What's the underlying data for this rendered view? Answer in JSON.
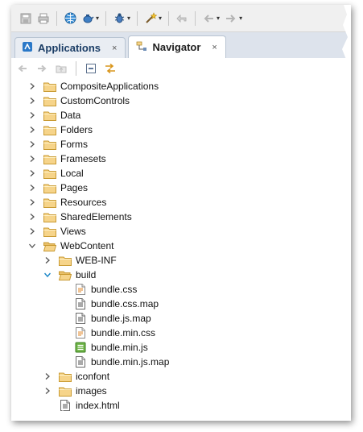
{
  "toolbar": {
    "icons": [
      "save-icon",
      "print-icon",
      "globe-icon",
      "teapot-icon",
      "bug-icon",
      "wand-icon",
      "back-icon",
      "forward-icon"
    ]
  },
  "tabs": [
    {
      "label": "Applications",
      "icon": "applications-icon",
      "close": "×",
      "active": false
    },
    {
      "label": "Navigator",
      "icon": "navigator-icon",
      "close": "×",
      "active": true
    }
  ],
  "viewbar": {
    "icons": [
      "back-arrow-icon",
      "forward-arrow-icon",
      "up-folder-icon",
      "collapse-all-icon",
      "link-editor-icon"
    ]
  },
  "tree": [
    {
      "label": "CompositeApplications",
      "depth": 0,
      "type": "folder",
      "expander": "collapsed"
    },
    {
      "label": "CustomControls",
      "depth": 0,
      "type": "folder",
      "expander": "collapsed"
    },
    {
      "label": "Data",
      "depth": 0,
      "type": "folder",
      "expander": "collapsed"
    },
    {
      "label": "Folders",
      "depth": 0,
      "type": "folder",
      "expander": "collapsed"
    },
    {
      "label": "Forms",
      "depth": 0,
      "type": "folder",
      "expander": "collapsed"
    },
    {
      "label": "Framesets",
      "depth": 0,
      "type": "folder",
      "expander": "collapsed"
    },
    {
      "label": "Local",
      "depth": 0,
      "type": "folder",
      "expander": "collapsed"
    },
    {
      "label": "Pages",
      "depth": 0,
      "type": "folder",
      "expander": "collapsed"
    },
    {
      "label": "Resources",
      "depth": 0,
      "type": "folder",
      "expander": "collapsed"
    },
    {
      "label": "SharedElements",
      "depth": 0,
      "type": "folder",
      "expander": "collapsed"
    },
    {
      "label": "Views",
      "depth": 0,
      "type": "folder",
      "expander": "collapsed"
    },
    {
      "label": "WebContent",
      "depth": 0,
      "type": "folder-open",
      "expander": "expanded"
    },
    {
      "label": "WEB-INF",
      "depth": 1,
      "type": "folder",
      "expander": "collapsed"
    },
    {
      "label": "build",
      "depth": 1,
      "type": "folder-open",
      "expander": "expanded-blue"
    },
    {
      "label": "bundle.css",
      "depth": 2,
      "type": "css-file",
      "expander": "none"
    },
    {
      "label": "bundle.css.map",
      "depth": 2,
      "type": "text-file",
      "expander": "none"
    },
    {
      "label": "bundle.js.map",
      "depth": 2,
      "type": "text-file",
      "expander": "none"
    },
    {
      "label": "bundle.min.css",
      "depth": 2,
      "type": "css-file",
      "expander": "none"
    },
    {
      "label": "bundle.min.js",
      "depth": 2,
      "type": "js-file",
      "expander": "none"
    },
    {
      "label": "bundle.min.js.map",
      "depth": 2,
      "type": "text-file",
      "expander": "none"
    },
    {
      "label": "iconfont",
      "depth": 1,
      "type": "folder",
      "expander": "collapsed"
    },
    {
      "label": "images",
      "depth": 1,
      "type": "folder",
      "expander": "collapsed"
    },
    {
      "label": "index.html",
      "depth": 1,
      "type": "html-file",
      "expander": "none"
    }
  ],
  "colors": {
    "folder_fill": "#f6d48a",
    "folder_stroke": "#c99a32",
    "tab_active_bg": "#ffffff",
    "tabbar_bg": "#dde3ec",
    "expander_blue": "#1e88c8"
  }
}
